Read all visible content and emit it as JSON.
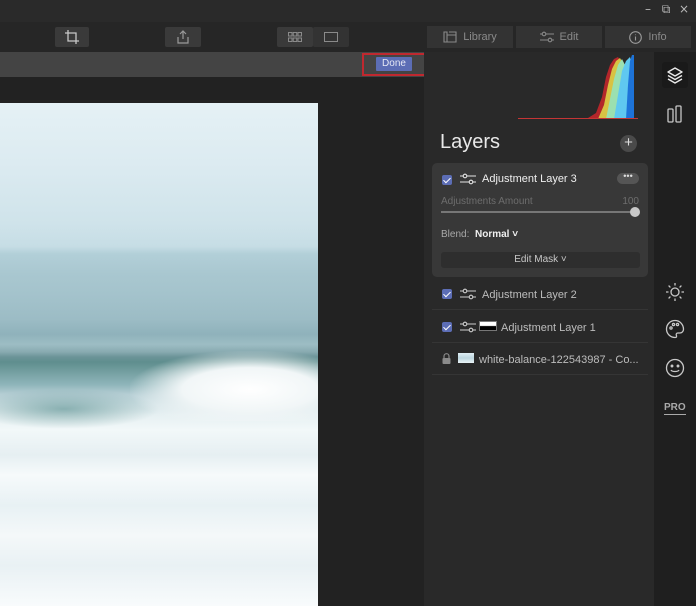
{
  "window": {
    "minimize": "–",
    "restore": "⧉",
    "close": "×"
  },
  "toolbar": {
    "tabs": [
      {
        "label": "Library",
        "icon": "library-icon"
      },
      {
        "label": "Edit",
        "icon": "sliders-icon"
      },
      {
        "label": "Info",
        "icon": "info-icon"
      }
    ]
  },
  "crop": {
    "done_label": "Done"
  },
  "panel": {
    "title": "Layers",
    "add_label": "+",
    "active_layer": {
      "name": "Adjustment Layer 3",
      "checked": true,
      "more_label": "•••",
      "amount_label": "Adjustments Amount",
      "amount_value": "100",
      "blend_label": "Blend:",
      "blend_value": "Normal ˅",
      "edit_mask_label": "Edit Mask ˅"
    },
    "layers": [
      {
        "name": "Adjustment Layer 2",
        "checked": true
      },
      {
        "name": "Adjustment Layer 1",
        "checked": true
      },
      {
        "name": "white-balance-122543987 - Co...",
        "locked": true
      }
    ]
  },
  "sidebar": {
    "pro_label": "PRO"
  },
  "colors": {
    "accent": "#5c6db5",
    "highlight_outline": "#c0282f",
    "panel_bg": "#292929"
  }
}
